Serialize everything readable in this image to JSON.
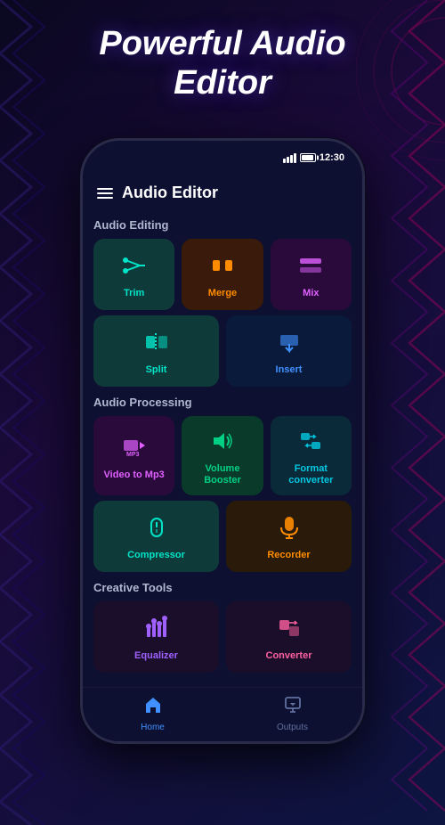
{
  "page": {
    "background_title_line1": "Powerful Audio",
    "background_title_line2": "Editor"
  },
  "app": {
    "title": "Audio Editor",
    "status_time": "12:30"
  },
  "sections": {
    "audio_editing": {
      "label": "Audio Editing",
      "tools": [
        {
          "id": "trim",
          "label": "Trim",
          "icon": "scissors"
        },
        {
          "id": "merge",
          "label": "Merge",
          "icon": "merge"
        },
        {
          "id": "mix",
          "label": "Mix",
          "icon": "mix"
        },
        {
          "id": "split",
          "label": "Split",
          "icon": "split"
        },
        {
          "id": "insert",
          "label": "Insert",
          "icon": "insert"
        }
      ]
    },
    "audio_processing": {
      "label": "Audio Processing",
      "tools": [
        {
          "id": "video-mp3",
          "label": "Video to Mp3",
          "icon": "video"
        },
        {
          "id": "volume",
          "label": "Volume Booster",
          "icon": "volume"
        },
        {
          "id": "format",
          "label": "Format converter",
          "icon": "format"
        },
        {
          "id": "compressor",
          "label": "Compressor",
          "icon": "compress"
        },
        {
          "id": "recorder",
          "label": "Recorder",
          "icon": "mic"
        }
      ]
    },
    "creative_tools": {
      "label": "Creative Tools",
      "tools": [
        {
          "id": "creative1",
          "label": "Equalizer",
          "icon": "eq"
        },
        {
          "id": "creative2",
          "label": "Converter",
          "icon": "convert"
        }
      ]
    }
  },
  "nav": {
    "items": [
      {
        "id": "home",
        "label": "Home",
        "active": true
      },
      {
        "id": "outputs",
        "label": "Outputs",
        "active": false
      }
    ]
  }
}
